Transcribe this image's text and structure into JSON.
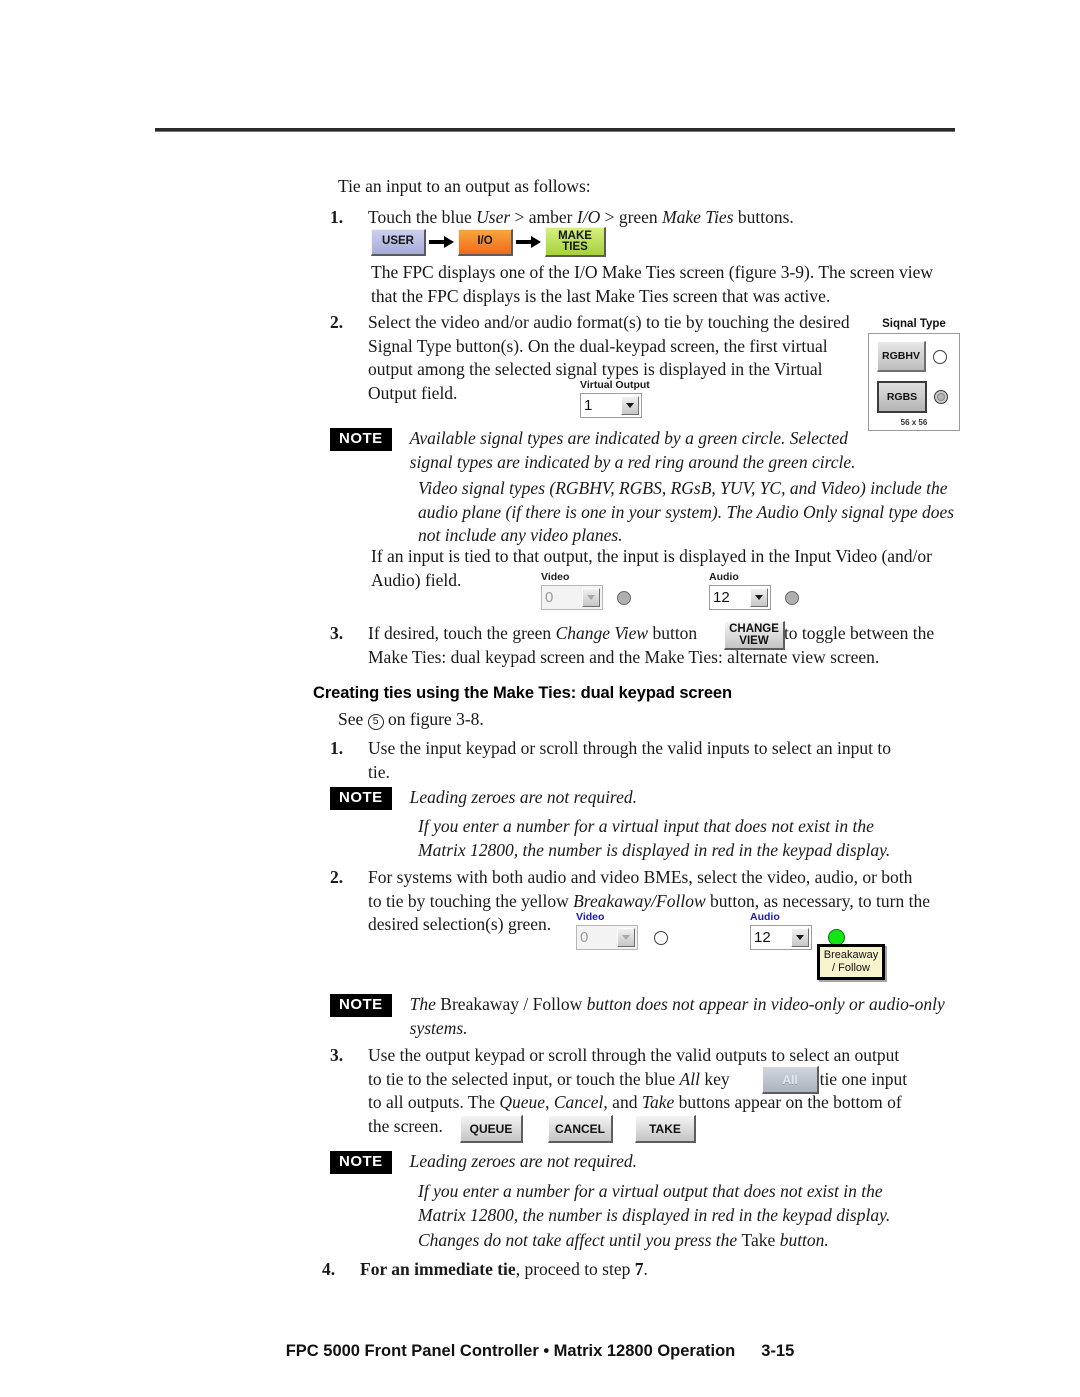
{
  "page": {
    "footer_title": "FPC 5000 Front Panel Controller • Matrix 12800 Operation",
    "page_number": "3-15"
  },
  "intro": {
    "lead": "Tie an input to an output as follows:"
  },
  "steps_primary": [
    {
      "num": "1.",
      "text_parts": [
        {
          "t": "Touch the blue ",
          "style": "roman"
        },
        {
          "t": "User",
          "style": "italic"
        },
        {
          "t": " > amber ",
          "style": "roman"
        },
        {
          "t": "I/O",
          "style": "italic"
        },
        {
          "t": " > green ",
          "style": "roman"
        },
        {
          "t": "Make Ties",
          "style": "italic"
        },
        {
          "t": " buttons.",
          "style": "roman"
        }
      ],
      "plain": "Touch the blue User > amber I/O > green Make Ties buttons.",
      "follow_up": "The FPC displays one of the I/O Make Ties screen (figure 3-9).  The screen view that the FPC displays is the last Make Ties screen that was active."
    },
    {
      "num": "2.",
      "plain": "Select the video and/or audio format(s) to tie by touching the desired Signal Type button(s).  On the dual-keypad screen, the first virtual output among the selected signal types is displayed in the Virtual Output field."
    },
    {
      "num": "3.",
      "plain": "If desired, touch the green Change View button",
      "plain_tail": "to toggle between the Make Ties: dual keypad screen and the Make Ties: alternate view screen."
    }
  ],
  "button_strip": {
    "user_label": "USER",
    "io_label": "I/O",
    "make_ties_line1": "MAKE",
    "make_ties_line2": "TIES",
    "user_color": "#a5abd8",
    "io_color": "#ef6a1c",
    "make_ties_color": "#a6d13d",
    "arrow_1": "arrow-right-icon",
    "arrow_2": "arrow-right-icon"
  },
  "signal_type_panel": {
    "title": "Siqnal Type",
    "rows": [
      {
        "label": "RGBHV",
        "selected": false,
        "indicator": "led-open"
      },
      {
        "label": "RGBS",
        "selected": true,
        "indicator": "led-ring"
      }
    ],
    "count_label": "56 x 56"
  },
  "virtual_output": {
    "label": "Virtual Output",
    "value": "1",
    "dimmed": false
  },
  "io_fields_1": {
    "video": {
      "label": "Video",
      "value": "0",
      "dimmed": true,
      "led": "led-gray",
      "label_color": "dark"
    },
    "audio": {
      "label": "Audio",
      "value": "12",
      "dimmed": false,
      "led": "led-gray",
      "label_color": "dark"
    }
  },
  "io_fields_2": {
    "video": {
      "label": "Video",
      "value": "0",
      "dimmed": true,
      "led": "led-open",
      "label_color": "blue"
    },
    "audio": {
      "label": "Audio",
      "value": "12",
      "dimmed": false,
      "led": "led-green",
      "label_color": "blue"
    },
    "breakaway": {
      "line1": "Breakaway",
      "line2": "/ Follow",
      "color": "#f7f4cd"
    }
  },
  "change_view_button": {
    "line1": "CHANGE",
    "line2": "VIEW"
  },
  "all_key": {
    "label": "All"
  },
  "bottom_buttons": [
    {
      "label": "QUEUE"
    },
    {
      "label": "CANCEL"
    },
    {
      "label": "TAKE"
    }
  ],
  "notes": {
    "note_label": "NOTE",
    "note1_line1": "Available signal types are indicated by a green circle.  Selected",
    "note1_line2": "signal types are indicated by a red ring around the green circle.",
    "note1_cont": "Video signal types (RGBHV, RGBS, RGsB, YUV, YC, and Video) include the audio plane (if there is one in your system).  The Audio Only signal type does not include any video planes.",
    "note2_main": "Leading zeroes are not required.",
    "note2_cont": "If you enter a number for a virtual input that does not exist in the Matrix 12800, the number is displayed in red in the keypad display.",
    "note3_main_pre": "The ",
    "note3_main_rom": "Breakaway / Follow",
    "note3_main_post": " button does not appear in video-only or audio-only",
    "note3_main_line2": "systems.",
    "note4_main": "Leading zeroes are not required.",
    "note4_cont_line1": "If you enter a number for a virtual output that does not exist in the",
    "note4_cont_line2": "Matrix 12800, the number is displayed in red in the keypad display.",
    "note4_cont2_pre": "Changes do not take affect until you press the ",
    "note4_cont2_rom": "Take",
    "note4_cont2_post": " button."
  },
  "dual_keypad_section": {
    "heading": "Creating ties using the Make Ties: dual keypad screen",
    "see_pre": "See ",
    "see_circle": "5",
    "see_post": " on figure 3-8.",
    "steps": [
      {
        "num": "1.",
        "line1": "Use the input keypad or scroll through the valid inputs to select an input to",
        "line2": "tie."
      },
      {
        "num": "2.",
        "line1": "For systems with both audio and video BMEs, select the video, audio, or both",
        "line2_pre": "to tie by touching the yellow ",
        "line2_ital": "Breakaway/Follow",
        "line2_post": " button, as necessary, to turn the",
        "line3": "desired selection(s) green."
      },
      {
        "num": "3.",
        "line1": "Use the output keypad or scroll through the valid outputs to select an output",
        "line2_pre": "to tie to the selected input, or touch the blue ",
        "line2_ital": "All",
        "line2_mid": " key",
        "line2_post": "to tie one input",
        "line3_pre": "to all outputs.  The ",
        "line3_ital1": "Queue",
        "line3_mid1": ", ",
        "line3_ital2": "Cancel",
        "line3_mid2": ", and ",
        "line3_ital3": "Take",
        "line3_post": " buttons appear on the bottom of",
        "line4": "the screen."
      },
      {
        "num": "4.",
        "bold": "For an immediate tie",
        "rest": ", proceed to step ",
        "step_ref": "7",
        "period": "."
      }
    ]
  }
}
